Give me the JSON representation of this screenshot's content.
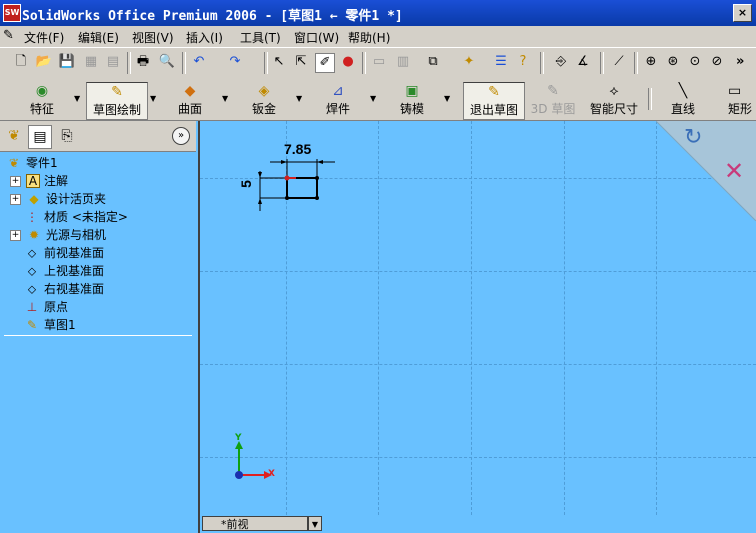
{
  "window": {
    "title": "SolidWorks Office Premium 2006 - [草图1 ← 零件1 *]",
    "app_icon": "SW",
    "close_glyph": "×"
  },
  "menu": [
    "文件(F)",
    "编辑(E)",
    "视图(V)",
    "插入(I)",
    "工具(T)",
    "窗口(W)",
    "帮助(H)"
  ],
  "toolbar_overflow": "»",
  "command_manager": {
    "feature": "特征",
    "sketch": "草图绘制",
    "surface": "曲面",
    "sheetmetal": "钣金",
    "weldment": "焊件",
    "mold": "铸模",
    "exit_sketch": "退出草图",
    "sketch3d": "3D 草图",
    "smart_dim": "智能尺寸",
    "line": "直线",
    "rect": "矩形"
  },
  "tree": {
    "root": "零件1",
    "items": [
      {
        "label": "注解",
        "expandable": true,
        "icon": "annotation-icon"
      },
      {
        "label": "设计活页夹",
        "expandable": true,
        "icon": "design-binder-icon"
      },
      {
        "label": "材质 <未指定>",
        "expandable": false,
        "icon": "material-icon"
      },
      {
        "label": "光源与相机",
        "expandable": true,
        "icon": "lights-cameras-icon"
      },
      {
        "label": "前视基准面",
        "expandable": false,
        "icon": "plane-icon"
      },
      {
        "label": "上视基准面",
        "expandable": false,
        "icon": "plane-icon"
      },
      {
        "label": "右视基准面",
        "expandable": false,
        "icon": "plane-icon"
      },
      {
        "label": "原点",
        "expandable": false,
        "icon": "origin-icon"
      },
      {
        "label": "草图1",
        "expandable": false,
        "icon": "sketch-icon"
      }
    ]
  },
  "sketch": {
    "dim_width": "7.85",
    "dim_height": "5"
  },
  "axes": {
    "x": "X",
    "y": "Y"
  },
  "view_tab": "*前视",
  "colors": {
    "viewport": "#69c1ff",
    "titlebar": "#0a3aa8",
    "dimension": "#000000",
    "axis_x": "#e02020",
    "axis_y": "#10a010"
  }
}
